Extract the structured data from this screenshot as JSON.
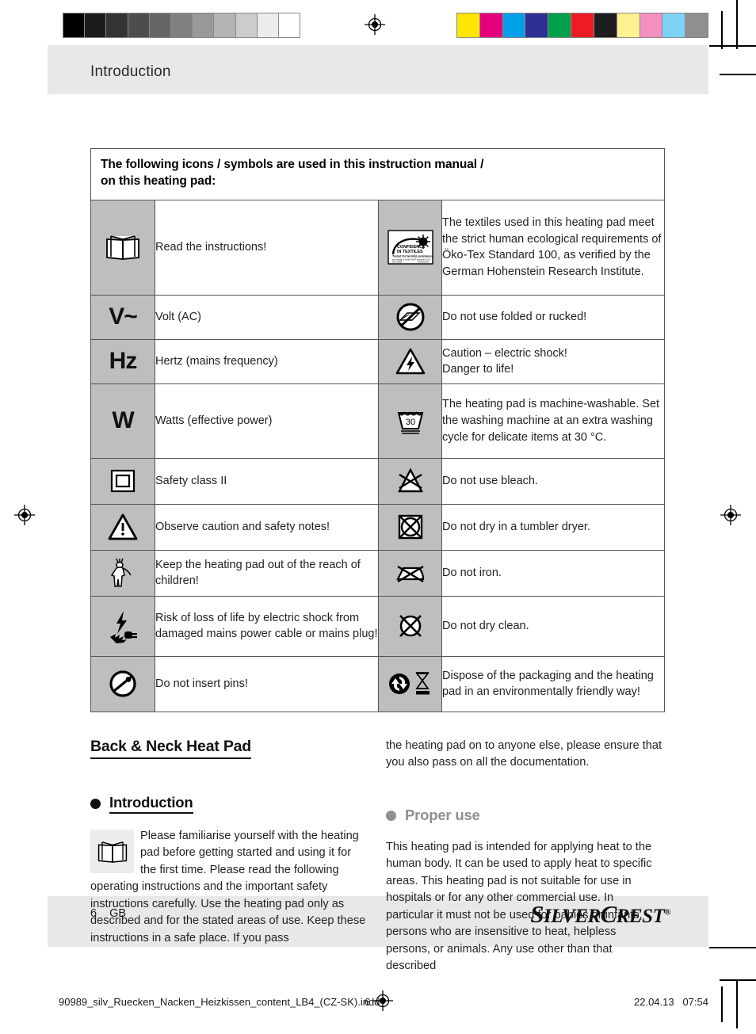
{
  "printer_marks": {
    "grayscale_steps": [
      "#000000",
      "#1c1c1c",
      "#333333",
      "#4d4d4d",
      "#666666",
      "#808080",
      "#999999",
      "#b3b3b3",
      "#cccccc",
      "#ececec",
      "#ffffff"
    ],
    "color_steps": [
      "#ffe600",
      "#e5007d",
      "#00a0e9",
      "#2e3192",
      "#00a04a",
      "#ed1c24",
      "#1e1e1e",
      "#fdf191",
      "#f48fc0",
      "#7ed2f5",
      "#8f8f8f"
    ],
    "registration_mark_label": "registration-target"
  },
  "header": {
    "running_head": "Introduction"
  },
  "symbol_table": {
    "caption": "The following icons / symbols are used in this instruction manual / on this heating pad:",
    "caption_line1": "The following icons / symbols are used in this instruction manual /",
    "caption_line2": "on this heating pad:",
    "rows": [
      {
        "left": {
          "icon": "open-book-icon",
          "icon_text": "",
          "text": "Read the instructions!"
        },
        "right": {
          "icon": "oeko-tex-confidence-in-textiles-logo",
          "icon_text": "",
          "text": "The textiles used in this heating pad meet the strict human ecological requirements of Öko-Tex Standard 100, as verified by the German Hohenstein Research Institute.",
          "logo": {
            "line1": "CONFIDENCE",
            "line2": "IN TEXTILES",
            "line3": "Tested for harmful substances",
            "line4": "according to Oeko-Tex® Standard 100",
            "line5a": "05.0.0551",
            "line5b": "Hohenstein"
          }
        }
      },
      {
        "left": {
          "icon": "volt-ac-symbol",
          "icon_text": "V~",
          "text": "Volt (AC)"
        },
        "right": {
          "icon": "do-not-use-folded-icon",
          "icon_text": "",
          "text": "Do not use folded or rucked!"
        }
      },
      {
        "left": {
          "icon": "hertz-symbol",
          "icon_text": "Hz",
          "text": "Hertz (mains frequency)"
        },
        "right": {
          "icon": "electric-shock-warning-icon",
          "icon_text": "",
          "text": "Caution – electric shock!\nDanger to life!",
          "text_line1": "Caution –  electric shock!",
          "text_line2": "Danger to life!"
        }
      },
      {
        "left": {
          "icon": "watt-symbol",
          "icon_text": "W",
          "text": "Watts (effective power)"
        },
        "right": {
          "icon": "machine-wash-30-icon",
          "icon_text": "30",
          "text": "The heating pad is machine-washable. Set the washing machine at an extra washing cycle for delicate items at 30 °C."
        }
      },
      {
        "left": {
          "icon": "safety-class-two-icon",
          "icon_text": "",
          "text": "Safety class II"
        },
        "right": {
          "icon": "do-not-bleach-icon",
          "icon_text": "",
          "text": "Do not use bleach."
        }
      },
      {
        "left": {
          "icon": "caution-warning-triangle-icon",
          "icon_text": "",
          "text": "Observe caution and safety notes!"
        },
        "right": {
          "icon": "do-not-tumble-dry-icon",
          "icon_text": "",
          "text": "Do not dry in a tumbler dryer."
        }
      },
      {
        "left": {
          "icon": "keep-away-from-children-icon",
          "icon_text": "",
          "text": "Keep the heating pad out of the reach of children!"
        },
        "right": {
          "icon": "do-not-iron-icon",
          "icon_text": "",
          "text": "Do not iron."
        }
      },
      {
        "left": {
          "icon": "damaged-plug-electric-shock-icon",
          "icon_text": "",
          "text": "Risk of loss of life by electric shock from damaged mains power cable or mains plug!"
        },
        "right": {
          "icon": "do-not-dry-clean-icon",
          "icon_text": "",
          "text": "Do not dry clean."
        }
      },
      {
        "left": {
          "icon": "do-not-insert-pins-icon",
          "icon_text": "",
          "text": "Do not insert pins!"
        },
        "right": {
          "icon": "recycle-and-weee-disposal-icon",
          "icon_text": "",
          "text": "Dispose of the packaging and the heating pad in an environmentally friendly way!"
        }
      }
    ]
  },
  "content": {
    "product_title": "Back & Neck Heat Pad",
    "intro_heading": "Introduction",
    "intro_paragraph": "Please familiarise yourself with the heating pad before getting started and using it for the first time. Please read the following operating instructions and the important safety instructions carefully. Use the heating pad only as described and for the stated areas of use. Keep these instructions in a safe place. If you pass",
    "intro_continuation": "the heating pad on to anyone else, please ensure that you also pass on all the documentation.",
    "proper_use_heading": "Proper use",
    "proper_use_paragraph": "This heating pad is intended for applying heat to the human body. It can be used to apply heat to specific areas. This heating pad is not suitable for use in hospitals or for any other commercial use. In particular it must not be used for babies or infants, persons who are insensitive to heat, helpless persons, or animals. Any use other than that described"
  },
  "footer": {
    "page_number": "6",
    "language_code": "GB",
    "brand_part1": "S",
    "brand_part2": "ILVER",
    "brand_part3": "C",
    "brand_part4": "REST",
    "brand_trademark": "®"
  },
  "indd_strip": {
    "filename": "90989_silv_Ruecken_Nacken_Heizkissen_content_LB4_(CZ-SK).indd",
    "page": "6",
    "date": "22.04.13",
    "time": "07:54"
  }
}
